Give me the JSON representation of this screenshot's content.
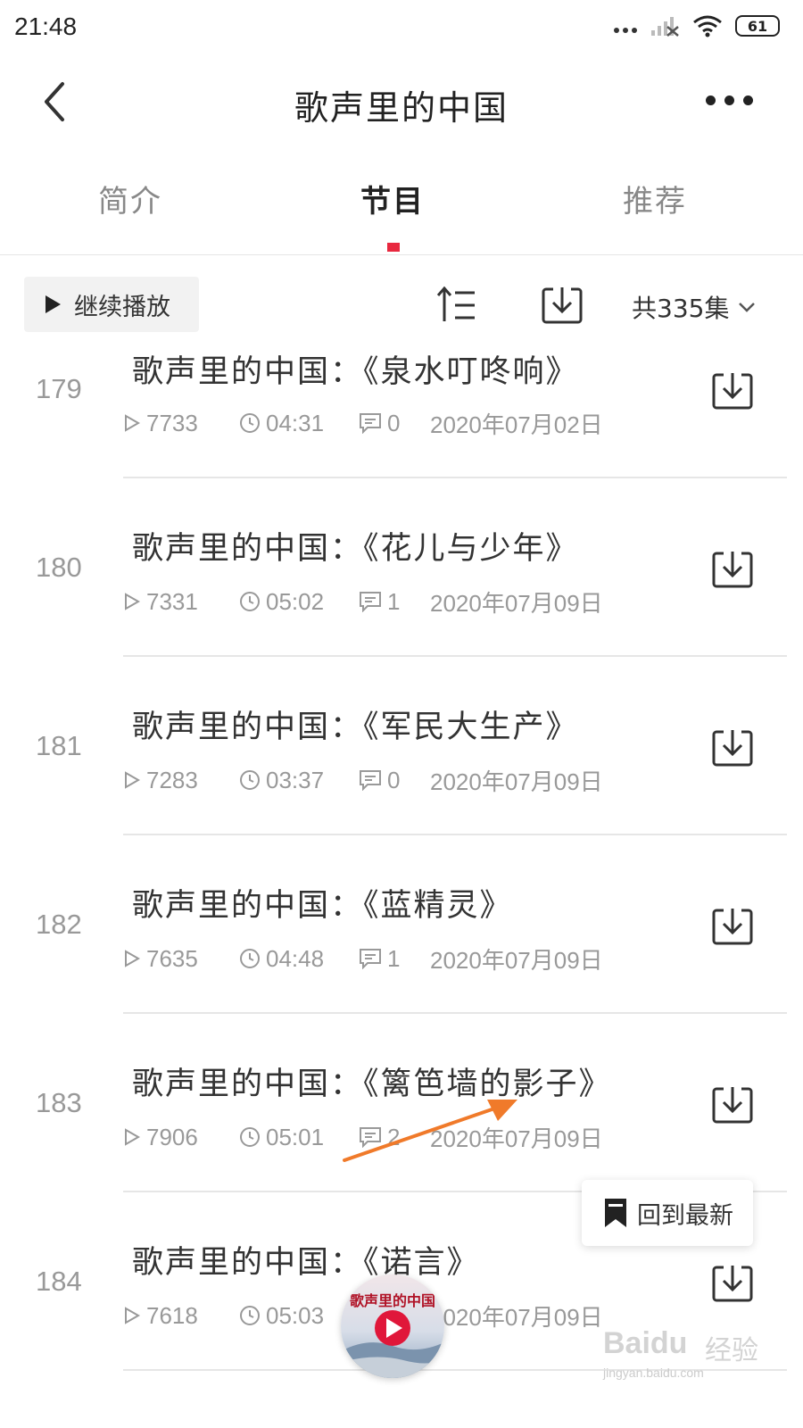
{
  "status_bar": {
    "time": "21:48",
    "battery": "61",
    "icons": [
      "more-dots-icon",
      "signal-icon",
      "wifi-icon",
      "battery-icon"
    ]
  },
  "nav": {
    "title": "歌声里的中国",
    "back_icon": "chevron-left-icon",
    "more_icon": "more-icon"
  },
  "tabs": [
    {
      "label": "简介",
      "active": false
    },
    {
      "label": "节目",
      "active": true
    },
    {
      "label": "推荐",
      "active": false
    }
  ],
  "toolbar": {
    "continue_label": "继续播放",
    "episode_count": "共335集",
    "sort_icon": "sort-icon",
    "download_all_icon": "download-icon"
  },
  "episodes": [
    {
      "num": "179",
      "title": "歌声里的中国：《泉水叮咚响》",
      "plays": "7733",
      "duration": "04:31",
      "comments": "0",
      "date": "2020年07月02日"
    },
    {
      "num": "180",
      "title": "歌声里的中国：《花儿与少年》",
      "plays": "7331",
      "duration": "05:02",
      "comments": "1",
      "date": "2020年07月09日"
    },
    {
      "num": "181",
      "title": "歌声里的中国：《军民大生产》",
      "plays": "7283",
      "duration": "03:37",
      "comments": "0",
      "date": "2020年07月09日"
    },
    {
      "num": "182",
      "title": "歌声里的中国：《蓝精灵》",
      "plays": "7635",
      "duration": "04:48",
      "comments": "1",
      "date": "2020年07月09日"
    },
    {
      "num": "183",
      "title": "歌声里的中国：《篱笆墙的影子》",
      "plays": "7906",
      "duration": "05:01",
      "comments": "2",
      "date": "2020年07月09日"
    },
    {
      "num": "184",
      "title": "歌声里的中国：《诺言》",
      "plays": "7618",
      "duration": "05:03",
      "comments": "",
      "date": "2020年07月09日"
    }
  ],
  "back_to_latest": "回到最新",
  "mini_player": {
    "cover_title": "歌声里的中国"
  },
  "watermark": {
    "brand": "Baidu",
    "suffix": "经验",
    "url": "jingyan.baidu.com"
  },
  "colors": {
    "accent": "#e8283f",
    "annotation_arrow": "#f07a2a",
    "text_primary": "#333333",
    "text_secondary": "#999999"
  }
}
